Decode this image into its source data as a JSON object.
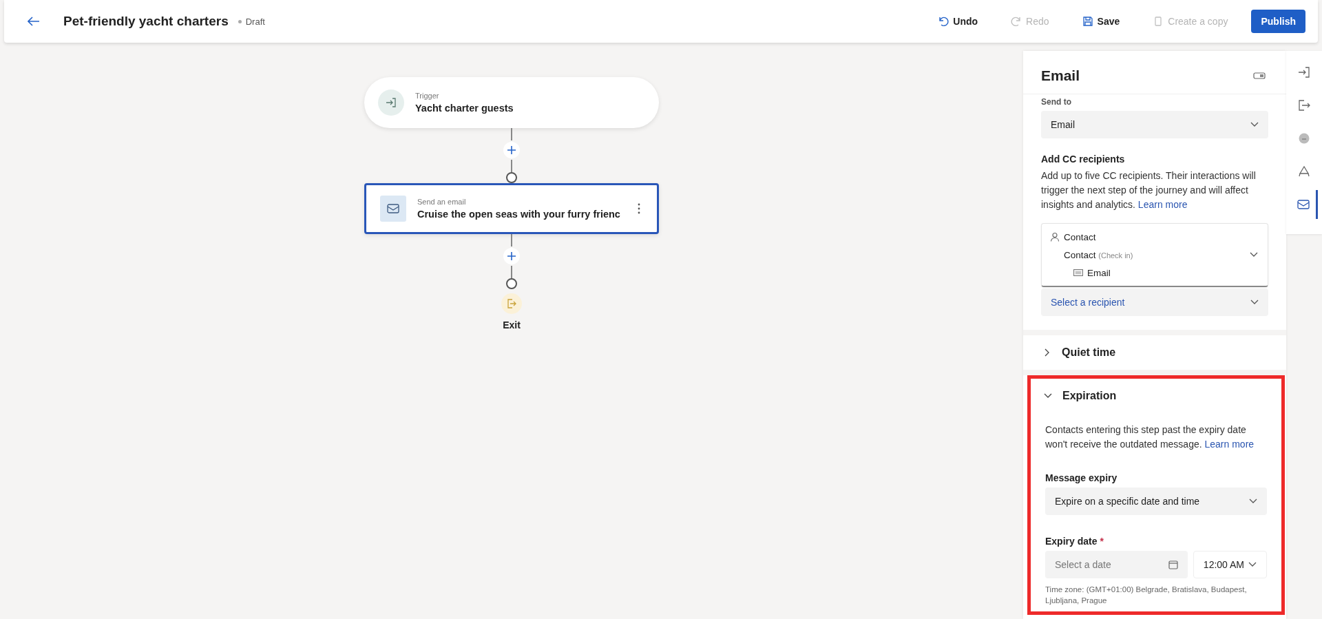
{
  "header": {
    "title": "Pet-friendly yacht charters",
    "status": "Draft",
    "actions": [
      {
        "kind": "undo",
        "label": "Undo",
        "disabled": false
      },
      {
        "kind": "redo",
        "label": "Redo",
        "disabled": true
      },
      {
        "kind": "save",
        "label": "Save",
        "disabled": false
      },
      {
        "kind": "copy",
        "label": "Create a copy",
        "disabled": true
      }
    ],
    "primary": "Publish"
  },
  "canvas": {
    "nodes": [
      {
        "kind": "trigger",
        "caption": "Trigger",
        "title": "Yacht charter guests",
        "selected": false
      },
      {
        "kind": "email",
        "caption": "Send an email",
        "title": "Cruise the open seas with your furry frienc",
        "selected": true
      }
    ],
    "exit": "Exit"
  },
  "panel": {
    "title": "Email",
    "send_to": {
      "label": "Send to",
      "value": "Email"
    },
    "cc": {
      "heading": "Add CC recipients",
      "description": "Add up to five CC recipients. Their interactions will trigger the next step of the journey and will affect insights and analytics.",
      "link": "Learn more",
      "tree": [
        {
          "label": "Contact",
          "children": [
            {
              "label": "Contact",
              "note": "(Check in)",
              "children": [
                {
                  "label": "Email"
                }
              ]
            }
          ]
        }
      ],
      "placeholder": "Select a recipient"
    },
    "quiet_time": {
      "title": "Quiet time",
      "expanded": false
    },
    "expiration": {
      "title": "Expiration",
      "expanded": true,
      "description": "Contacts entering this step past the expiry date won't receive the outdated message.",
      "link": "Learn more",
      "message_expiry": {
        "label": "Message expiry",
        "value": "Expire on a specific date and time"
      },
      "expiry_date": {
        "label": "Expiry date",
        "required": true,
        "required_mark": "*",
        "placeholder": "Select a date",
        "time": "12:00 AM"
      },
      "timezone": "Time zone: (GMT+01:00) Belgrade, Bratislava, Budapest, Ljubljana, Prague"
    }
  },
  "rail": [
    {
      "kind": "enter",
      "selected": false
    },
    {
      "kind": "exit",
      "selected": false
    },
    {
      "kind": "circle",
      "selected": false
    },
    {
      "kind": "share",
      "selected": false
    },
    {
      "kind": "email",
      "selected": true
    }
  ]
}
